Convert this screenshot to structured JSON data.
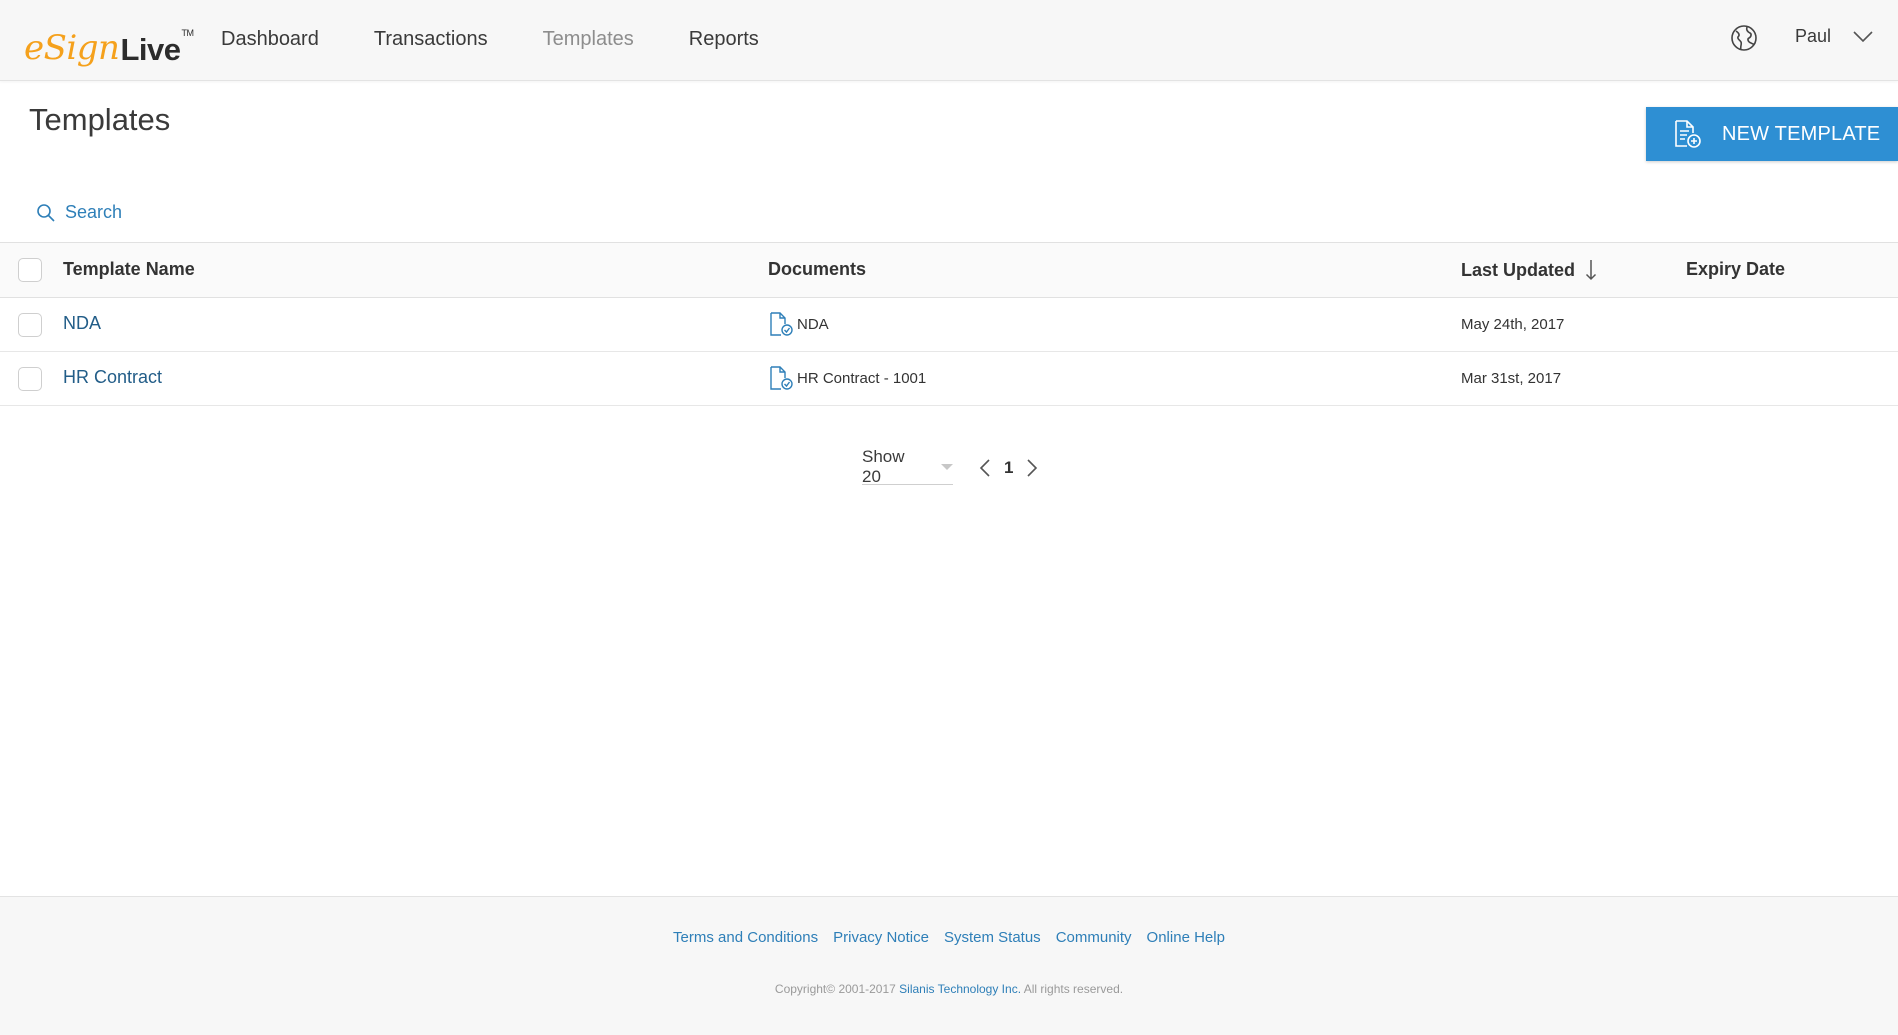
{
  "brand": {
    "logo_e": "e",
    "logo_sign": "Sign",
    "logo_live": "Live",
    "logo_tm": "TM"
  },
  "nav": {
    "items": [
      {
        "label": "Dashboard"
      },
      {
        "label": "Transactions"
      },
      {
        "label": "Templates",
        "active": true
      },
      {
        "label": "Reports"
      }
    ]
  },
  "header": {
    "globe_icon": "globe-icon",
    "user_name": "Paul"
  },
  "page": {
    "title": "Templates",
    "new_button_label": "NEW TEMPLATE",
    "new_button_icon": "document-add-icon"
  },
  "search": {
    "placeholder": "Search"
  },
  "table": {
    "columns": {
      "name": "Template Name",
      "documents": "Documents",
      "last_updated": "Last Updated",
      "expiry": "Expiry Date"
    },
    "sort": {
      "column": "last_updated",
      "direction": "descending"
    },
    "rows": [
      {
        "name": "NDA",
        "document": "NDA",
        "last_updated": "May 24th, 2017",
        "expiry": ""
      },
      {
        "name": "HR Contract",
        "document": "HR Contract - 1001",
        "last_updated": "Mar 31st, 2017",
        "expiry": ""
      }
    ]
  },
  "pagination": {
    "show_label": "Show 20",
    "current_page": "1"
  },
  "footer": {
    "links": [
      {
        "label": "Terms and Conditions"
      },
      {
        "label": "Privacy Notice"
      },
      {
        "label": "System Status"
      },
      {
        "label": "Community"
      },
      {
        "label": "Online Help"
      }
    ],
    "copyright_prefix": "Copyright© 2001-2017",
    "company": "Silanis Technology Inc.",
    "rights": "All rights reserved."
  },
  "colors": {
    "accent": "#2e8fd3",
    "link": "#2e7fb8",
    "row_link": "#225d88",
    "logo_orange": "#f5a11c"
  }
}
